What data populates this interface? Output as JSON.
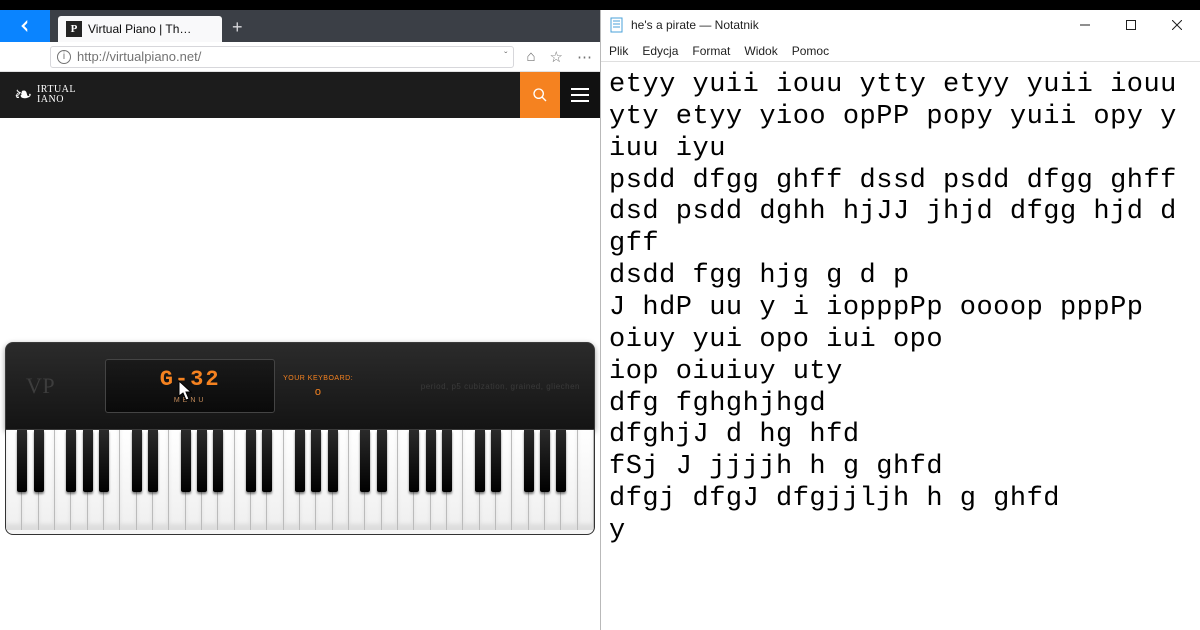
{
  "browser": {
    "tab_title": "Virtual Piano | The Origin...",
    "favicon_letter": "P",
    "url": "http://virtualpiano.net/",
    "newtab_glyph": "+",
    "toolbar": {
      "home_glyph": "⌂",
      "star_glyph": "☆",
      "menu_glyph": "⋯"
    }
  },
  "site": {
    "logo_text": "IRTUAL\nIANO",
    "logo_letters": "VP"
  },
  "piano": {
    "brand_main": "VP",
    "brand_sub": "IRTUAL\nIANO",
    "display_note": "G-32",
    "menu_label": "MENU",
    "kbd_label": "YOUR KEYBOARD:",
    "kbd_value": "o",
    "speaker_text": "period, p5 cubization, grained, gliechen"
  },
  "notepad": {
    "title": "he's a pirate — Notatnik",
    "menus": [
      "Plik",
      "Edycja",
      "Format",
      "Widok",
      "Pomoc"
    ],
    "content": "etyy yuii iouu ytty etyy yuii iouu yty etyy yioo opPP popy yuii opy yiuu iyu\npsdd dfgg ghff dssd psdd dfgg ghff dsd psdd dghh hjJJ jhjd dfgg hjd dgff\ndsdd fgg hjg g d p\nJ hdP uu y i iopppPp oooop pppPp\noiuy yui opo iui opo\niop oiuiuy uty\ndfg fghghjhgd\ndfghjJ d hg hfd\nfSj J jjjjh h g ghfd\ndfgj dfgJ dfgjjljh h g ghfd\ny"
  }
}
